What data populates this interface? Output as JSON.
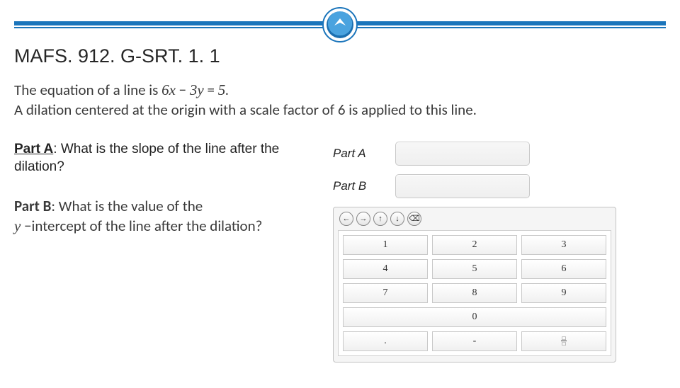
{
  "header": {
    "standard_code": "MAFS. 912. G-SRT. 1. 1"
  },
  "problem": {
    "line1_pre": "The equation of a line is ",
    "eq_lhs_a": "6",
    "eq_var_x": "x",
    "eq_minus": " − ",
    "eq_lhs_b": "3",
    "eq_var_y": "y",
    "eq_eq": " = ",
    "eq_rhs": "5.",
    "line2": "A dilation  centered at the origin with a scale factor of 6 is applied to this line."
  },
  "partA": {
    "label": "Part A",
    "colon": ": ",
    "question": "What is the slope of the line after the dilation?"
  },
  "partB": {
    "label": "Part B",
    "colon": ": ",
    "q_pre": "What is the value of the ",
    "q_var": "y",
    "q_post": " −intercept of the line after the dilation?"
  },
  "answers": {
    "a_label": "Part A",
    "b_label": "Part B"
  },
  "keypad": {
    "tools": [
      "←",
      "→",
      "↑",
      "↓",
      "⌫"
    ],
    "rows": [
      [
        "1",
        "2",
        "3"
      ],
      [
        "4",
        "5",
        "6"
      ],
      [
        "7",
        "8",
        "9"
      ]
    ],
    "zero": "0",
    "dot": ".",
    "minus": "-",
    "frac_top": "□",
    "frac_bot": "□"
  }
}
